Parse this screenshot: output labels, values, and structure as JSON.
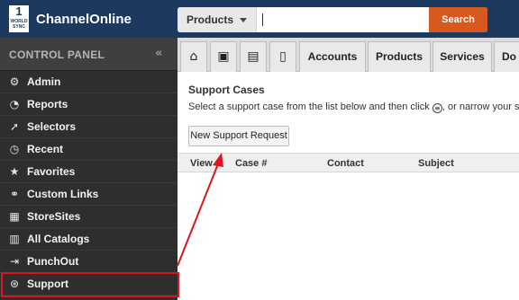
{
  "header": {
    "logo_number": "1",
    "logo_sub": "WORLD SYNC",
    "brand": "ChannelOnline",
    "search_scope": "Products",
    "search_value": "",
    "search_button": "Search"
  },
  "sidebar": {
    "title": "CONTROL PANEL",
    "collapse_glyph": "«",
    "items": [
      {
        "label": "Admin",
        "icon": "gear-icon"
      },
      {
        "label": "Reports",
        "icon": "pie-chart-icon"
      },
      {
        "label": "Selectors",
        "icon": "cursor-icon"
      },
      {
        "label": "Recent",
        "icon": "history-icon"
      },
      {
        "label": "Favorites",
        "icon": "star-icon"
      },
      {
        "label": "Custom Links",
        "icon": "link-icon"
      },
      {
        "label": "StoreSites",
        "icon": "store-icon"
      },
      {
        "label": "All Catalogs",
        "icon": "book-icon"
      },
      {
        "label": "PunchOut",
        "icon": "punchout-icon"
      },
      {
        "label": "Support",
        "icon": "lifebuoy-icon"
      }
    ]
  },
  "tabs": {
    "icons": [
      "home-icon",
      "contact-card-icon",
      "building-icon",
      "document-icon"
    ],
    "labels": [
      "Accounts",
      "Products",
      "Services",
      "Do"
    ]
  },
  "main": {
    "title": "Support Cases",
    "instruction_before": "Select a support case from the list below and then click",
    "instruction_after": ", or narrow your search",
    "new_button": "New Support Request",
    "columns": [
      "View",
      "Case #",
      "Contact",
      "Subject"
    ]
  },
  "annotation_color": "#e0141e"
}
